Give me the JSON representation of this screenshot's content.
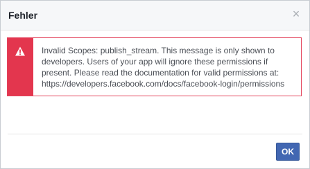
{
  "dialog": {
    "title": "Fehler",
    "close_glyph": "×",
    "close_icon": "close-icon",
    "error": {
      "icon": "warning-icon",
      "message": "Invalid Scopes: publish_stream. This message is only shown to developers. Users of your app will ignore these permissions if present. Please read the documentation for valid permissions at: https://developers.facebook.com/docs/facebook-login/permissions",
      "accent_color": "#e3364e"
    },
    "ok_label": "OK",
    "button_color": "#4267b2"
  }
}
